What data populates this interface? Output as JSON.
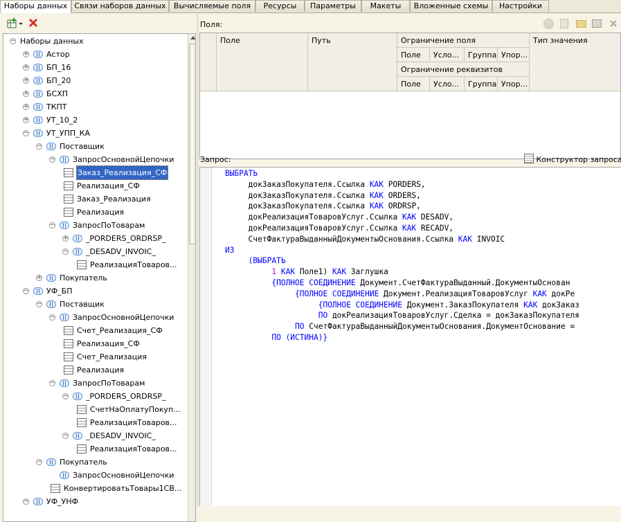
{
  "tabs": [
    {
      "label": "Наборы данных",
      "active": true
    },
    {
      "label": "Связи наборов данных"
    },
    {
      "label": "Вычисляемые поля"
    },
    {
      "label": "Ресурсы"
    },
    {
      "label": "Параметры"
    },
    {
      "label": "Макеты"
    },
    {
      "label": "Вложенные схемы"
    },
    {
      "label": "Настройки"
    }
  ],
  "left_toolbar": {
    "add_icon": "add-dataset-icon",
    "delete_icon": "delete-icon"
  },
  "tree": [
    {
      "label": "Наборы данных",
      "level": 0,
      "expander": "minus",
      "icon": "none"
    },
    {
      "label": "Астор",
      "level": 1,
      "expander": "plus",
      "icon": "node"
    },
    {
      "label": "БП_16",
      "level": 1,
      "expander": "plus",
      "icon": "node"
    },
    {
      "label": "БП_20",
      "level": 1,
      "expander": "plus",
      "icon": "node"
    },
    {
      "label": "БСХП",
      "level": 1,
      "expander": "plus",
      "icon": "node"
    },
    {
      "label": "ТКПТ",
      "level": 1,
      "expander": "plus",
      "icon": "node"
    },
    {
      "label": "УТ_10_2",
      "level": 1,
      "expander": "plus",
      "icon": "node"
    },
    {
      "label": "УТ_УПП_КА",
      "level": 1,
      "expander": "minus",
      "icon": "node"
    },
    {
      "label": "Поставщик",
      "level": 2,
      "expander": "minus",
      "icon": "node"
    },
    {
      "label": "ЗапросОсновнойЦепочки",
      "level": 3,
      "expander": "minus",
      "icon": "node"
    },
    {
      "label": "Заказ_Реализация_СФ",
      "level": 4,
      "expander": "none",
      "icon": "table",
      "selected": true
    },
    {
      "label": "Реализация_СФ",
      "level": 4,
      "expander": "none",
      "icon": "table"
    },
    {
      "label": "Заказ_Реализация",
      "level": 4,
      "expander": "none",
      "icon": "table"
    },
    {
      "label": "Реализация",
      "level": 4,
      "expander": "none",
      "icon": "table"
    },
    {
      "label": "ЗапросПоТоварам",
      "level": 3,
      "expander": "minus",
      "icon": "node"
    },
    {
      "label": "_PORDERS_ORDRSP_",
      "level": 4,
      "expander": "plus",
      "icon": "node"
    },
    {
      "label": "_DESADV_INVOIC_",
      "level": 4,
      "expander": "minus",
      "icon": "node"
    },
    {
      "label": "РеализацияТоваров...",
      "level": 5,
      "expander": "none",
      "icon": "table"
    },
    {
      "label": "Покупатель",
      "level": 2,
      "expander": "plus",
      "icon": "node"
    },
    {
      "label": "УФ_БП",
      "level": 1,
      "expander": "minus",
      "icon": "node"
    },
    {
      "label": "Поставщик",
      "level": 2,
      "expander": "minus",
      "icon": "node"
    },
    {
      "label": "ЗапросОсновнойЦепочки",
      "level": 3,
      "expander": "minus",
      "icon": "node"
    },
    {
      "label": "Счет_Реализация_СФ",
      "level": 4,
      "expander": "none",
      "icon": "table"
    },
    {
      "label": "Реализация_СФ",
      "level": 4,
      "expander": "none",
      "icon": "table"
    },
    {
      "label": "Счет_Реализация",
      "level": 4,
      "expander": "none",
      "icon": "table"
    },
    {
      "label": "Реализация",
      "level": 4,
      "expander": "none",
      "icon": "table"
    },
    {
      "label": "ЗапросПоТоварам",
      "level": 3,
      "expander": "minus",
      "icon": "node"
    },
    {
      "label": "_PORDERS_ORDRSP_",
      "level": 4,
      "expander": "minus",
      "icon": "node"
    },
    {
      "label": "СчетНаОплатуПокуп...",
      "level": 5,
      "expander": "none",
      "icon": "table"
    },
    {
      "label": "РеализацияТоваров...",
      "level": 5,
      "expander": "none",
      "icon": "table"
    },
    {
      "label": "_DESADV_INVOIC_",
      "level": 4,
      "expander": "minus",
      "icon": "node"
    },
    {
      "label": "РеализацияТоваров...",
      "level": 5,
      "expander": "none",
      "icon": "table"
    },
    {
      "label": "Покупатель",
      "level": 2,
      "expander": "minus",
      "icon": "node"
    },
    {
      "label": "ЗапросОсновнойЦепочки",
      "level": 3,
      "expander": "none",
      "icon": "node"
    },
    {
      "label": "КонвертироватьТовары1СВ...",
      "level": 3,
      "expander": "none",
      "icon": "table"
    },
    {
      "label": "УФ_УНФ",
      "level": 1,
      "expander": "minus",
      "icon": "node"
    }
  ],
  "fields_label": "Поля:",
  "fields_grid": {
    "field": "Поле",
    "path": "Путь",
    "field_restriction": "Ограничение поля",
    "attr_restriction": "Ограничение реквизитов",
    "value_type": "Тип значения",
    "sub": [
      "Поле",
      "Усло...",
      "Группа",
      "Упор..."
    ]
  },
  "right_toolbar_icons": [
    "check-icon",
    "copy-icon",
    "folder-add-icon",
    "table-add-icon",
    "close-icon"
  ],
  "query_label": "Запрос:",
  "query_builder_label": "Конструктор запроса...",
  "query_lines": [
    [
      {
        "t": "ВЫБРАТЬ",
        "c": "kw"
      }
    ],
    [
      {
        "t": "     докЗаказПокупателя.Ссылка "
      },
      {
        "t": "КАК",
        "c": "kw"
      },
      {
        "t": " PORDERS,"
      }
    ],
    [
      {
        "t": "     докЗаказПокупателя.Ссылка "
      },
      {
        "t": "КАК",
        "c": "kw"
      },
      {
        "t": " ORDERS,"
      }
    ],
    [
      {
        "t": "     докЗаказПокупателя.Ссылка "
      },
      {
        "t": "КАК",
        "c": "kw"
      },
      {
        "t": " ORDRSP,"
      }
    ],
    [
      {
        "t": "     докРеализацияТоваровУслуг.Ссылка "
      },
      {
        "t": "КАК",
        "c": "kw"
      },
      {
        "t": " DESADV,"
      }
    ],
    [
      {
        "t": "     докРеализацияТоваровУслуг.Ссылка "
      },
      {
        "t": "КАК",
        "c": "kw"
      },
      {
        "t": " RECADV,"
      }
    ],
    [
      {
        "t": "     СчетФактураВыданныйДокументыОснования.Ссылка "
      },
      {
        "t": "КАК",
        "c": "kw"
      },
      {
        "t": " INVOIC"
      }
    ],
    [
      {
        "t": "ИЗ",
        "c": "kw"
      }
    ],
    [
      {
        "t": "     "
      },
      {
        "t": "(ВЫБРАТЬ",
        "c": "kw"
      }
    ],
    [
      {
        "t": "          "
      },
      {
        "t": "1",
        "c": "num"
      },
      {
        "t": " "
      },
      {
        "t": "КАК",
        "c": "kw"
      },
      {
        "t": " Поле1) "
      },
      {
        "t": "КАК",
        "c": "kw"
      },
      {
        "t": " Заглушка"
      }
    ],
    [
      {
        "t": "          "
      },
      {
        "t": "{ПОЛНОЕ СОЕДИНЕНИЕ",
        "c": "kw"
      },
      {
        "t": " Документ.СчетФактураВыданный.ДокументыОснован"
      }
    ],
    [
      {
        "t": "               "
      },
      {
        "t": "{ПОЛНОЕ СОЕДИНЕНИЕ",
        "c": "kw"
      },
      {
        "t": " Документ.РеализацияТоваровУслуг "
      },
      {
        "t": "КАК",
        "c": "kw"
      },
      {
        "t": " докРе"
      }
    ],
    [
      {
        "t": "                    "
      },
      {
        "t": "{ПОЛНОЕ СОЕДИНЕНИЕ",
        "c": "kw"
      },
      {
        "t": " Документ.ЗаказПокупателя "
      },
      {
        "t": "КАК",
        "c": "kw"
      },
      {
        "t": " докЗаказ"
      }
    ],
    [
      {
        "t": "                    "
      },
      {
        "t": "ПО",
        "c": "kw"
      },
      {
        "t": " докРеализацияТоваровУслуг.Сделка = докЗаказПокупателя"
      }
    ],
    [
      {
        "t": "               "
      },
      {
        "t": "ПО",
        "c": "kw"
      },
      {
        "t": " СчетФактураВыданныйДокументыОснования.ДокументОснование ="
      }
    ],
    [
      {
        "t": "          "
      },
      {
        "t": "ПО (ИСТИНА)}",
        "c": "kw"
      }
    ]
  ]
}
